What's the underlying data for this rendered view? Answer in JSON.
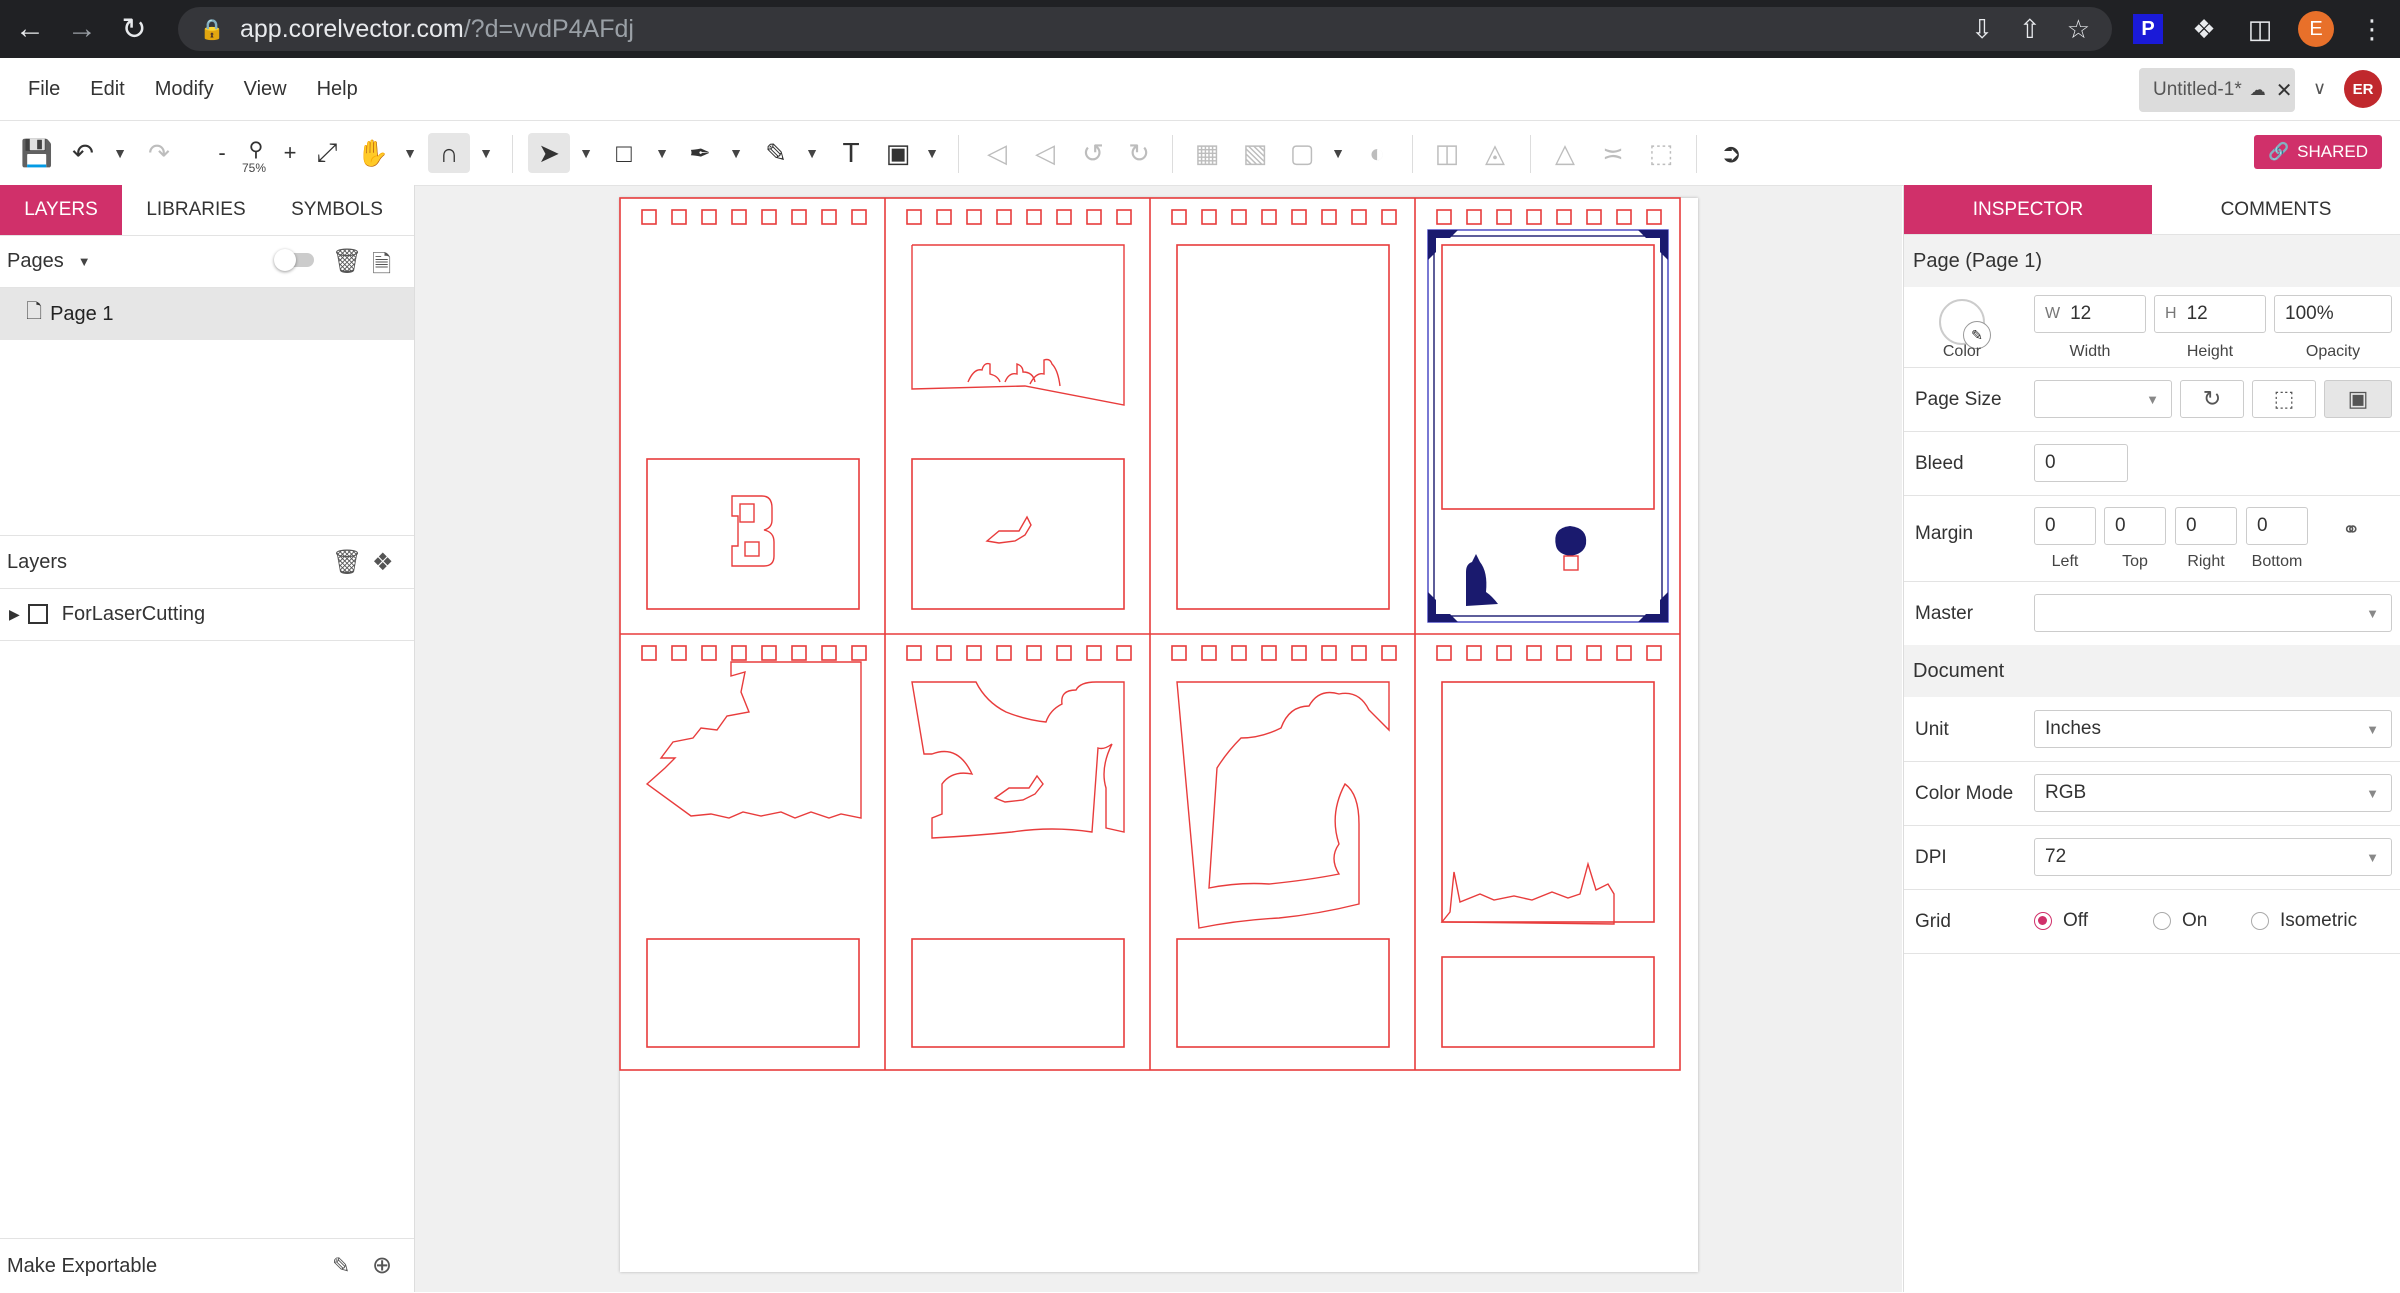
{
  "browser": {
    "url_host": "app.corelvector.com",
    "url_path": "/?d=vvdP4AFdj",
    "profile_initial": "E",
    "ext_p": "P"
  },
  "menu": [
    "File",
    "Edit",
    "Modify",
    "View",
    "Help"
  ],
  "doc_tab": {
    "title": "Untitled-1*"
  },
  "user_initials": "ER",
  "toolbar": {
    "zoom": "75%",
    "shared": "SHARED"
  },
  "left_panel": {
    "tabs": [
      "LAYERS",
      "LIBRARIES",
      "SYMBOLS"
    ],
    "pages_label": "Pages",
    "page_item": "Page 1",
    "layers_label": "Layers",
    "layer_item": "ForLaserCutting",
    "export_label": "Make Exportable"
  },
  "right_panel": {
    "tabs": [
      "INSPECTOR",
      "COMMENTS"
    ],
    "page_header": "Page (Page 1)",
    "color_label": "Color",
    "width": {
      "prefix": "W",
      "value": "12",
      "label": "Width"
    },
    "height": {
      "prefix": "H",
      "value": "12",
      "label": "Height"
    },
    "opacity": {
      "value": "100%",
      "label": "Opacity"
    },
    "page_size_label": "Page Size",
    "bleed_label": "Bleed",
    "bleed_value": "0",
    "margin_label": "Margin",
    "margins": [
      {
        "value": "0",
        "label": "Left"
      },
      {
        "value": "0",
        "label": "Top"
      },
      {
        "value": "0",
        "label": "Right"
      },
      {
        "value": "0",
        "label": "Bottom"
      }
    ],
    "master_label": "Master",
    "document_header": "Document",
    "unit_label": "Unit",
    "unit_value": "Inches",
    "color_mode_label": "Color Mode",
    "color_mode_value": "RGB",
    "dpi_label": "DPI",
    "dpi_value": "72",
    "grid_label": "Grid",
    "grid_options": [
      "Off",
      "On",
      "Isometric"
    ]
  },
  "colors": {
    "accent": "#d0306a",
    "cut_line": "#e83c3c",
    "selection": "#1a1a6e"
  }
}
